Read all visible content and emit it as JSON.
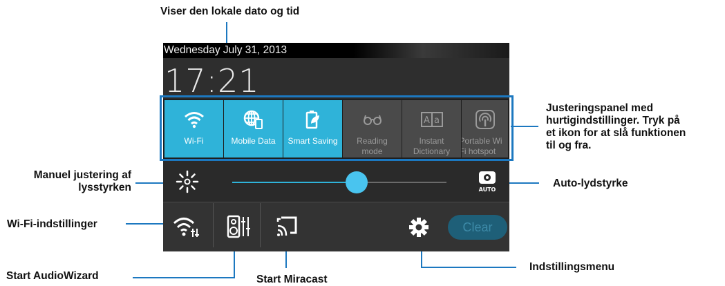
{
  "status": {
    "date": "Wednesday  July 31, 2013",
    "time": "17:21"
  },
  "quick_settings": [
    {
      "label": "Wi-Fi",
      "state": "on",
      "icon": "wifi-icon"
    },
    {
      "label": "Mobile Data",
      "state": "on",
      "icon": "mobile-data-icon"
    },
    {
      "label": "Smart Saving",
      "state": "on",
      "icon": "smart-saving-icon"
    },
    {
      "label": "Reading\nmode",
      "state": "off",
      "icon": "reading-mode-icon"
    },
    {
      "label": "Instant\nDictionary",
      "state": "off",
      "icon": "instant-dictionary-icon"
    },
    {
      "label": "Portable Wi\nFi hotspot",
      "state": "off",
      "icon": "hotspot-icon"
    }
  ],
  "brightness": {
    "level": 0.58,
    "auto_label": "AUTO"
  },
  "bottom": {
    "clear_label": "Clear"
  },
  "callouts": {
    "datetime": "Viser den lokale dato og tid",
    "quick_panel": "Justeringspanel med hurtigindstillinger. Tryk på et ikon for at slå funktionen til og fra.",
    "quick_panel_lines": [
      "Justeringspanel med",
      "hurtigindstillinger. Tryk på",
      "et ikon for at slå funktionen",
      "til og fra."
    ],
    "brightness": "Manuel justering af lysstyrken",
    "brightness_lines": [
      "Manuel justering af",
      "lysstyrken"
    ],
    "auto": "Auto-lydstyrke",
    "wifi_settings": "Wi-Fi-indstillinger",
    "audiowizard": "Start AudioWizard",
    "miracast": "Start Miracast",
    "settings_menu": "Indstillingsmenu"
  },
  "colors": {
    "accent": "#2fb3d9",
    "callout_line": "#1c78c0"
  }
}
